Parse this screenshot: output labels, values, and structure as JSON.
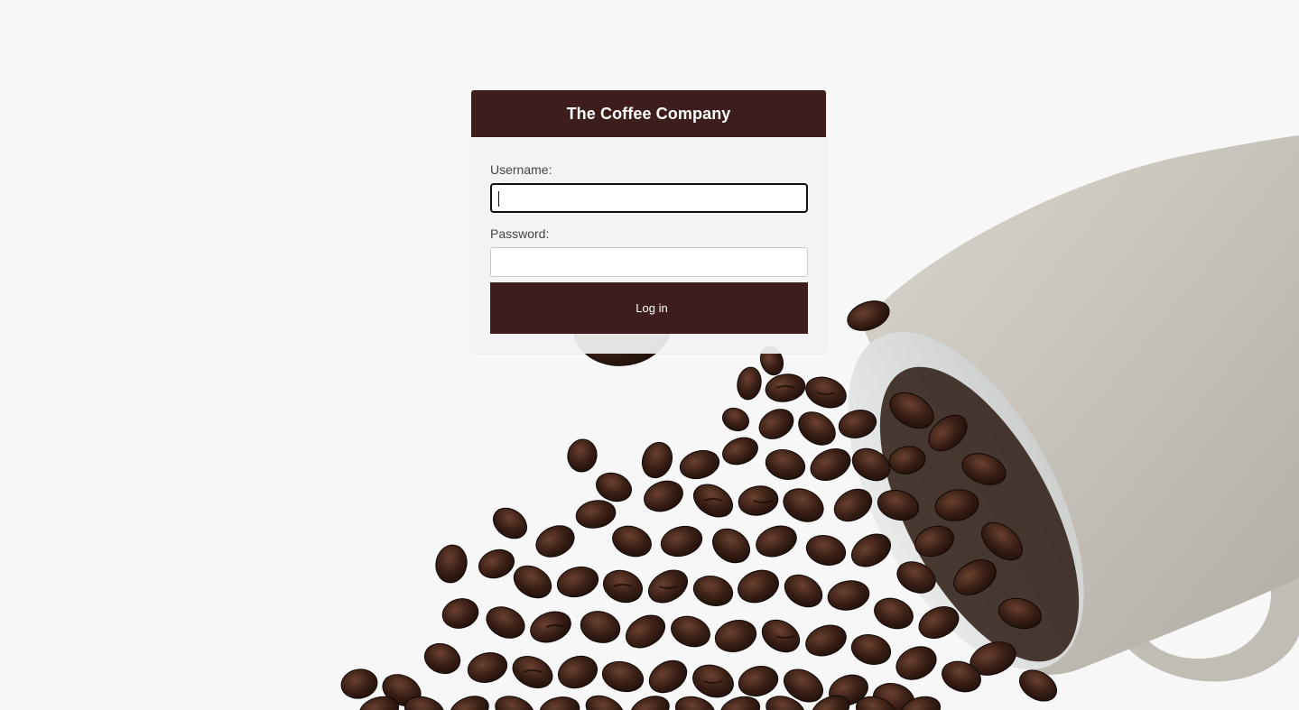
{
  "app": {
    "title": "The Coffee Company"
  },
  "login": {
    "username_label": "Username:",
    "username_value": "",
    "password_label": "Password:",
    "password_value": "",
    "submit_label": "Log in"
  },
  "colors": {
    "brand": "#3e1e1d",
    "background": "#f7f7f8",
    "mug": "#cbc6bd"
  }
}
